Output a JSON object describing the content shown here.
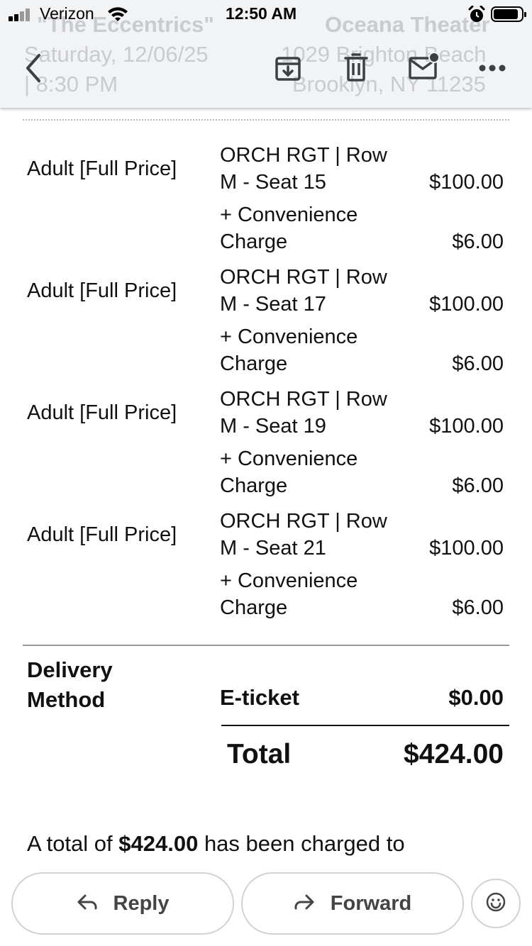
{
  "status_bar": {
    "carrier": "Verizon",
    "time": "12:50 AM"
  },
  "header_ghost": {
    "event_title": "\"The Eccentrics\"",
    "event_datetime_line1": "Saturday, 12/06/25",
    "event_datetime_line2": "| 8:30 PM",
    "venue_name": "Oceana Theater",
    "venue_address_line1": "1029 Brighton Beach",
    "venue_address_line2": "Brooklyn, NY 11235"
  },
  "toolbar": {
    "icons": [
      "back-icon",
      "archive-icon",
      "trash-icon",
      "mark-unread-icon",
      "more-icon"
    ]
  },
  "tickets": [
    {
      "type": "Adult [Full Price]",
      "seat_line1": "ORCH RGT | Row",
      "seat_line2": "M - Seat 15",
      "price": "$100.00",
      "fee_line1": "+ Convenience",
      "fee_line2": "Charge",
      "fee": "$6.00"
    },
    {
      "type": "Adult [Full Price]",
      "seat_line1": "ORCH RGT | Row",
      "seat_line2": "M - Seat 17",
      "price": "$100.00",
      "fee_line1": "+ Convenience",
      "fee_line2": "Charge",
      "fee": "$6.00"
    },
    {
      "type": "Adult [Full Price]",
      "seat_line1": "ORCH RGT | Row",
      "seat_line2": "M - Seat 19",
      "price": "$100.00",
      "fee_line1": "+ Convenience",
      "fee_line2": "Charge",
      "fee": "$6.00"
    },
    {
      "type": "Adult [Full Price]",
      "seat_line1": "ORCH RGT | Row",
      "seat_line2": "M - Seat 21",
      "price": "$100.00",
      "fee_line1": "+ Convenience",
      "fee_line2": "Charge",
      "fee": "$6.00"
    }
  ],
  "delivery": {
    "label_line1": "Delivery",
    "label_line2": "Method",
    "method": "E-ticket",
    "price": "$0.00"
  },
  "total": {
    "label": "Total",
    "value": "$424.00"
  },
  "charged_text": {
    "prefix": "A total of ",
    "amount": "$424.00",
    "suffix": " has been charged to"
  },
  "actions": {
    "reply": "Reply",
    "forward": "Forward"
  },
  "colors": {
    "topbar_bg": "#f2f3f5",
    "text": "#111111",
    "icon": "#5f6368"
  }
}
